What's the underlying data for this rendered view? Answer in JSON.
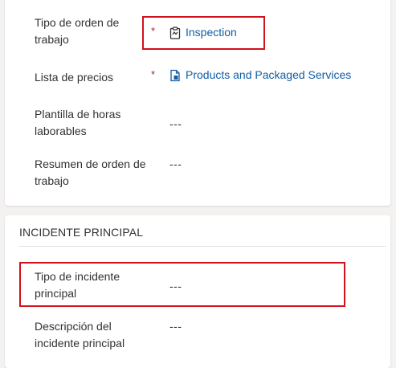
{
  "general": {
    "work_order_type_label": "Tipo de orden de trabajo",
    "work_order_type_value": "Inspection",
    "price_list_label": "Lista de precios",
    "price_list_value": "Products and Packaged Services",
    "working_hours_template_label": "Plantilla de horas laborables",
    "working_hours_template_value": "---",
    "work_order_summary_label": "Resumen de orden de trabajo",
    "work_order_summary_value": "---",
    "required_marker": "*"
  },
  "primary_incident": {
    "section_title": "INCIDENTE PRINCIPAL",
    "incident_type_label": "Tipo de incidente principal",
    "incident_type_value": "---",
    "incident_description_label": "Descripción del incidente principal",
    "incident_description_value": "---"
  },
  "icons": {
    "work_order_type": "clipboard-icon",
    "price_list": "document-list-icon"
  },
  "colors": {
    "link": "#115ea3",
    "required": "#a4262c",
    "highlight": "#d1111c"
  }
}
